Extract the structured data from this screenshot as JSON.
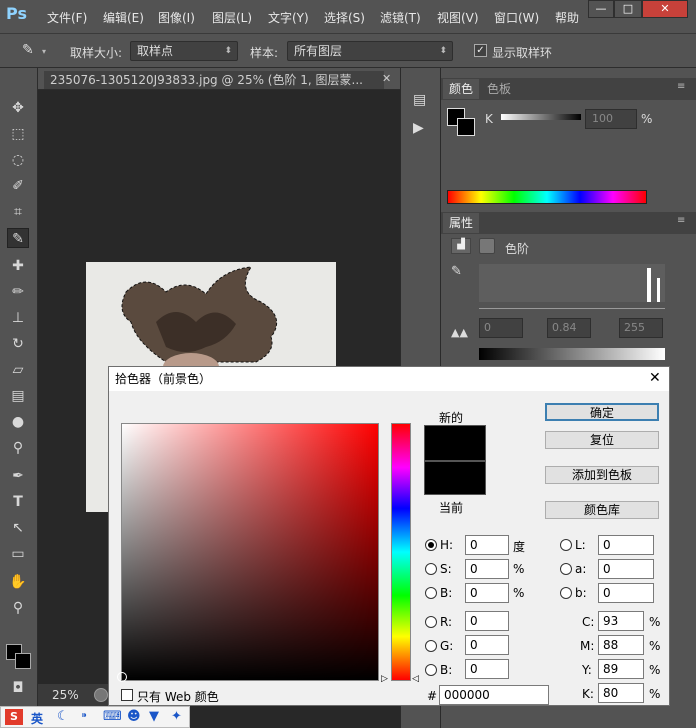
{
  "app": {
    "logo": "Ps"
  },
  "menubar": {
    "items": [
      "文件(F)",
      "编辑(E)",
      "图像(I)",
      "图层(L)",
      "文字(Y)",
      "选择(S)",
      "滤镜(T)",
      "视图(V)",
      "窗口(W)",
      "帮助"
    ],
    "window_buttons": [
      "—",
      "□",
      "✕"
    ]
  },
  "options": {
    "sample_size_label": "取样大小:",
    "sample_size_value": "取样点",
    "sample_label": "样本:",
    "sample_value": "所有图层",
    "show_ring_label": "显示取样环",
    "show_ring_checked": true
  },
  "document": {
    "tab_title": "235076-1305120J93833.jpg @ 25% (色阶 1, 图层蒙...",
    "zoom": "25%"
  },
  "panels": {
    "color_tab": "颜色",
    "swatches_tab": "色板",
    "k_label": "K",
    "k_value": "100",
    "k_unit": "%",
    "properties_tab": "属性",
    "levels_label": "色阶",
    "levels_values": [
      "0",
      "0.84",
      "255"
    ]
  },
  "dialog": {
    "title": "拾色器（前景色）",
    "new_label": "新的",
    "current_label": "当前",
    "buttons": {
      "ok": "确定",
      "reset": "复位",
      "add_swatch": "添加到色板",
      "color_library": "颜色库"
    },
    "hsb": [
      {
        "label": "H:",
        "value": "0",
        "unit": "度",
        "selected": true
      },
      {
        "label": "S:",
        "value": "0",
        "unit": "%"
      },
      {
        "label": "B:",
        "value": "0",
        "unit": "%"
      }
    ],
    "rgb": [
      {
        "label": "R:",
        "value": "0"
      },
      {
        "label": "G:",
        "value": "0"
      },
      {
        "label": "B:",
        "value": "0"
      }
    ],
    "lab": [
      {
        "label": "L:",
        "value": "0"
      },
      {
        "label": "a:",
        "value": "0"
      },
      {
        "label": "b:",
        "value": "0"
      }
    ],
    "cmyk": [
      {
        "label": "C:",
        "value": "93",
        "unit": "%"
      },
      {
        "label": "M:",
        "value": "88",
        "unit": "%"
      },
      {
        "label": "Y:",
        "value": "89",
        "unit": "%"
      },
      {
        "label": "K:",
        "value": "80",
        "unit": "%"
      }
    ],
    "hex_label": "#",
    "hex_value": "000000",
    "web_only_label": "只有 Web 颜色",
    "new_color": "#000000",
    "current_color": "#000000"
  },
  "taskbar": {
    "ime_label": "英"
  }
}
